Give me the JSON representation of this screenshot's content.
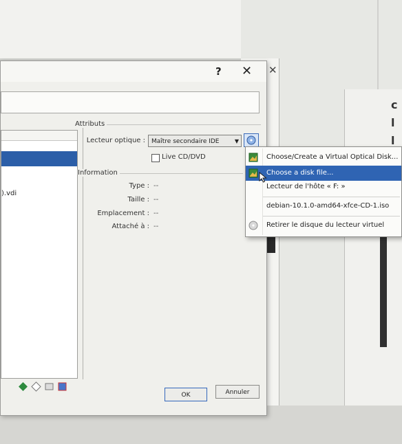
{
  "dialog": {
    "help_label": "?",
    "close_label": "✕",
    "tree_item": ").vdi",
    "ok_label": "OK",
    "cancel_label": "Annuler"
  },
  "attributes": {
    "group_title": "Attributs",
    "optical_drive_label": "Lecteur optique :",
    "optical_drive_value": "Maître secondaire IDE",
    "live_cd_label": "Live CD/DVD"
  },
  "information": {
    "group_title": "Information",
    "rows": [
      {
        "label": "Type :",
        "value": "--"
      },
      {
        "label": "Taille :",
        "value": "--"
      },
      {
        "label": "Emplacement :",
        "value": "--"
      },
      {
        "label": "Attaché à :",
        "value": "--"
      }
    ]
  },
  "menu": {
    "items": [
      {
        "label": "Choose/Create a Virtual Optical Disk...",
        "icon": "optical-disk-icon"
      },
      {
        "label": "Choose a disk file...",
        "icon": "disk-file-icon"
      },
      {
        "label": "Lecteur de l'hôte « F: »",
        "icon": ""
      },
      {
        "label": "debian-10.1.0-amd64-xfce-CD-1.iso",
        "icon": ""
      },
      {
        "label": "Retirer le disque du lecteur virtuel",
        "icon": "remove-disk-icon"
      }
    ]
  },
  "background": {
    "close_label": "✕",
    "letters": [
      "c",
      "l",
      "l",
      "1"
    ]
  },
  "colors": {
    "selection": "#2f64b3",
    "tree_selection": "#2b5ea8",
    "dialog_bg": "#f0f0ec"
  }
}
